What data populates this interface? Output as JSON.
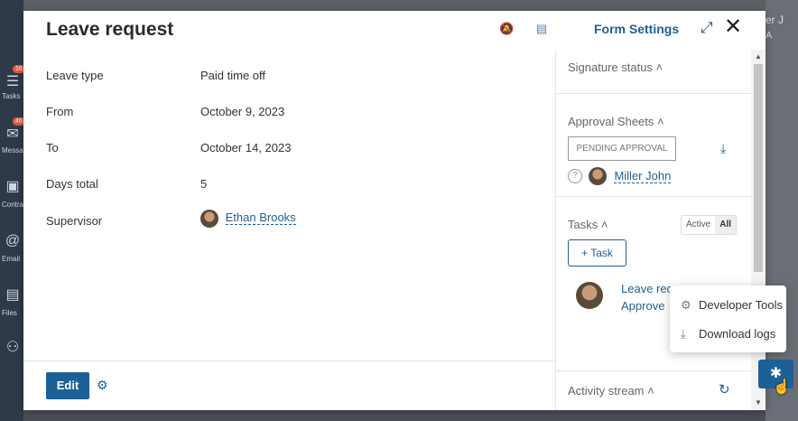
{
  "background": {
    "user_name": "iller J",
    "user_sub": "MA",
    "sidebar": [
      {
        "label": "Tasks",
        "badge": "16"
      },
      {
        "label": "Message",
        "badge": "46"
      },
      {
        "label": "Contra"
      },
      {
        "label": "Email"
      },
      {
        "label": "Files"
      }
    ]
  },
  "modal": {
    "title": "Leave request",
    "form_settings": "Form Settings",
    "fields": [
      {
        "label": "Leave type",
        "value": "Paid time off"
      },
      {
        "label": "From",
        "value": "October 9, 2023"
      },
      {
        "label": "To",
        "value": "October 14, 2023"
      },
      {
        "label": "Days total",
        "value": "5"
      },
      {
        "label": "Supervisor",
        "value": "Ethan Brooks"
      }
    ],
    "edit_label": "Edit"
  },
  "panel": {
    "signature_status": "Signature status",
    "approval_sheets": "Approval Sheets",
    "pending": "PENDING APPROVAL",
    "approver": "Miller John",
    "tasks": "Tasks",
    "filter_active": "Active",
    "filter_all": "All",
    "task_button": "Task",
    "task_line1": "Leave req",
    "task_line2": "Approve",
    "activity_stream": "Activity stream"
  },
  "popup": {
    "developer_tools": "Developer Tools",
    "download_logs": "Download logs"
  },
  "colors": {
    "accent": "#1d5f97"
  }
}
